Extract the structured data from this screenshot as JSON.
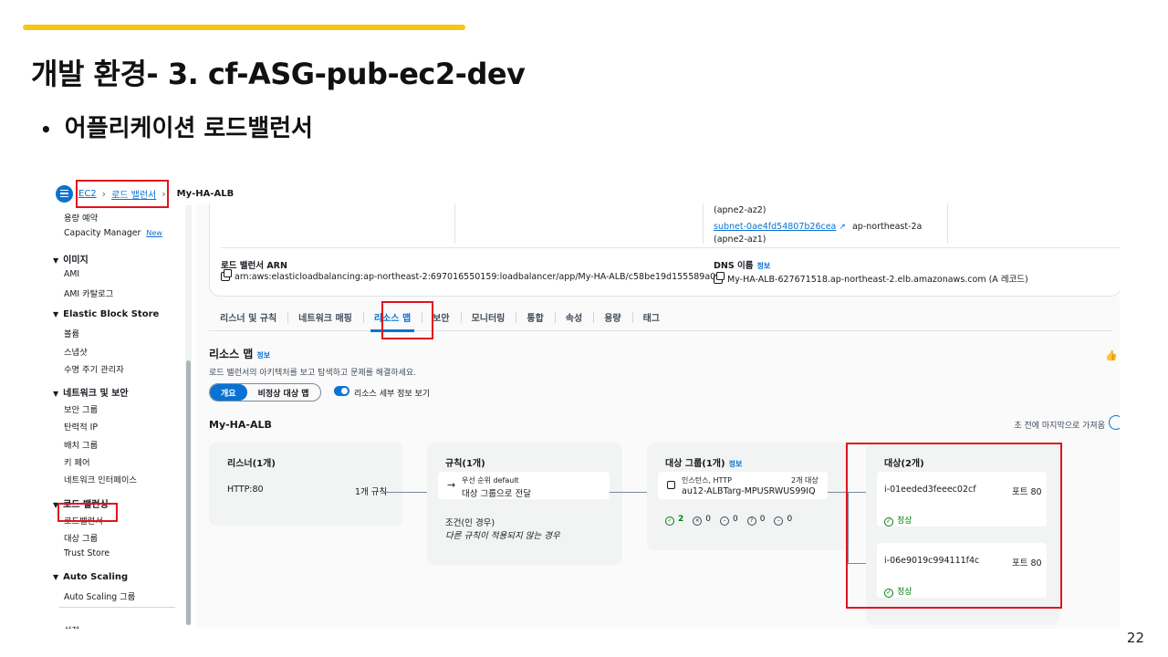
{
  "slide": {
    "title": "개발 환경- 3. cf-ASG-pub-ec2-dev",
    "bullet": "어플리케이션 로드밸런서",
    "page_number": "22"
  },
  "breadcrumb": {
    "items": [
      "EC2",
      "로드 밸런서"
    ],
    "current": "My-HA-ALB"
  },
  "sidebar": {
    "items": [
      {
        "type": "item",
        "label": "용량 예약"
      },
      {
        "type": "item",
        "label": "Capacity Manager",
        "badge": "New"
      },
      {
        "type": "head",
        "label": "이미지"
      },
      {
        "type": "item",
        "label": "AMI"
      },
      {
        "type": "item",
        "label": "AMI 카탈로그"
      },
      {
        "type": "head",
        "label": "Elastic Block Store"
      },
      {
        "type": "item",
        "label": "볼륨"
      },
      {
        "type": "item",
        "label": "스냅샷"
      },
      {
        "type": "item",
        "label": "수명 주기 관리자"
      },
      {
        "type": "head",
        "label": "네트워크 및 보안"
      },
      {
        "type": "item",
        "label": "보안 그룹"
      },
      {
        "type": "item",
        "label": "탄력적 IP"
      },
      {
        "type": "item",
        "label": "배치 그룹"
      },
      {
        "type": "item",
        "label": "키 페어"
      },
      {
        "type": "item",
        "label": "네트워크 인터페이스"
      },
      {
        "type": "head",
        "label": "로드 밸런싱"
      },
      {
        "type": "item",
        "label": "로드밸런서",
        "selected": true
      },
      {
        "type": "item",
        "label": "대상 그룹"
      },
      {
        "type": "item",
        "label": "Trust Store"
      },
      {
        "type": "head",
        "label": "Auto Scaling"
      },
      {
        "type": "item",
        "label": "Auto Scaling 그룹"
      }
    ],
    "cut_off_label": "설정"
  },
  "details": {
    "az2": "(apne2-az2)",
    "subnet_link": "subnet-0ae4fd54807b26cea",
    "subnet_region": "ap-northeast-2a",
    "az1": "(apne2-az1)",
    "arn_label": "로드 밸런서 ARN",
    "arn_value": "arn:aws:elasticloadbalancing:ap-northeast-2:697016550159:loadbalancer/app/My-HA-ALB/c58be19d155589a0",
    "dns_label": "DNS 이름",
    "dns_info": "정보",
    "dns_value": "My-HA-ALB-627671518.ap-northeast-2.elb.amazonaws.com (A 레코드)"
  },
  "tabs": [
    "리스너 및 규칙",
    "네트워크 매핑",
    "리소스 맵",
    "보안",
    "모니터링",
    "통합",
    "속성",
    "용량",
    "태그"
  ],
  "active_tab": "리소스 맵",
  "resource_map": {
    "title": "리소스 맵",
    "info": "정보",
    "description": "로드 밸런서의 아키텍처를 보고 탐색하고 문제를 해결하세요.",
    "segment_on": "개요",
    "segment_off": "비정상 대상 맵",
    "toggle_label": "리소스 세부 정보 보기",
    "lb_name": "My-HA-ALB",
    "refresh_text": "초 전에 마지막으로 가져옴"
  },
  "listeners": {
    "title": "리스너(1개)",
    "protocol": "HTTP:80",
    "rule_count": "1개 규칙"
  },
  "rules": {
    "title": "규칙(1개)",
    "priority": "우선 순위 default",
    "action": "대상 그룹으로 전달",
    "condition_label": "조건(인 경우)",
    "condition_value": "다른 규칙이 적용되지 않는 경우"
  },
  "target_groups": {
    "title": "대상 그룹(1개)",
    "info": "정보",
    "type": "인스턴스, HTTP",
    "target_count": "2개 대상",
    "name": "au12-ALBTarg-MPUSRWUS99IQ",
    "stats": [
      "2",
      "0",
      "0",
      "0",
      "0"
    ]
  },
  "targets": {
    "title": "대상(2개)",
    "items": [
      {
        "id": "i-01eeded3feeec02cf",
        "port": "포트 80",
        "status": "정상"
      },
      {
        "id": "i-06e9019c994111f4c",
        "port": "포트 80",
        "status": "정상"
      }
    ]
  },
  "colors": {
    "accent": "#0972d3",
    "highlight": "#e0141e",
    "title_bar": "#f5c518",
    "healthy": "#037f0c"
  }
}
